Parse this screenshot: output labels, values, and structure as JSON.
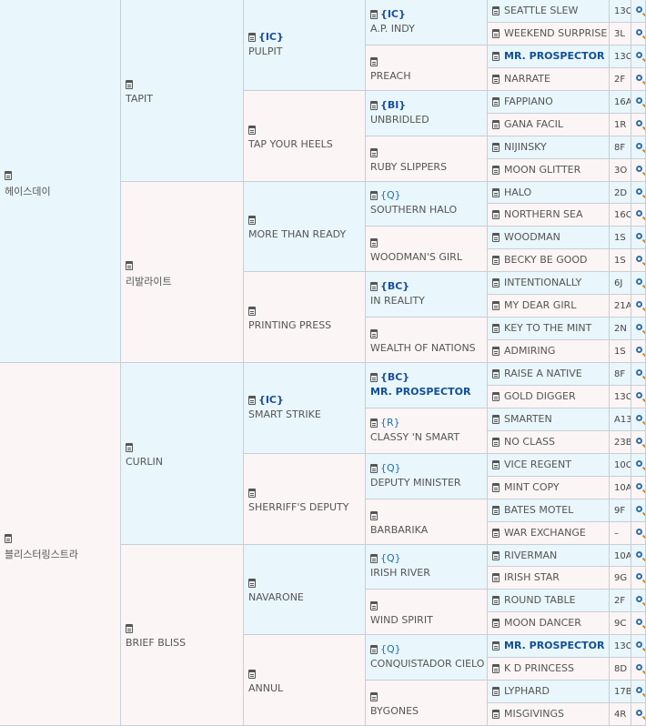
{
  "gen1": [
    "헤이스데이",
    "블리스터링스트라"
  ],
  "gen2": [
    "TAPIT",
    "리발라이트",
    "CURLIN",
    "BRIEF BLISS"
  ],
  "gen3": [
    {
      "badge": "{IC}",
      "name": "PULPIT"
    },
    {
      "badge": "",
      "name": "TAP YOUR HEELS"
    },
    {
      "badge": "",
      "name": "MORE THAN READY"
    },
    {
      "badge": "",
      "name": "PRINTING PRESS"
    },
    {
      "badge": "{IC}",
      "name": "SMART STRIKE"
    },
    {
      "badge": "",
      "name": "SHERRIFF'S DEPUTY"
    },
    {
      "badge": "",
      "name": "NAVARONE"
    },
    {
      "badge": "",
      "name": "ANNUL"
    }
  ],
  "gen4": [
    {
      "badge": "{IC}",
      "name": "A.P. INDY",
      "hl": false,
      "light": false
    },
    {
      "badge": "",
      "name": "PREACH",
      "hl": false,
      "light": false
    },
    {
      "badge": "{BI}",
      "name": "UNBRIDLED",
      "hl": false,
      "light": false
    },
    {
      "badge": "",
      "name": "RUBY SLIPPERS",
      "hl": false,
      "light": false
    },
    {
      "badge": "{Q}",
      "name": "SOUTHERN HALO",
      "hl": false,
      "light": true
    },
    {
      "badge": "",
      "name": "WOODMAN'S GIRL",
      "hl": false,
      "light": false
    },
    {
      "badge": "{BC}",
      "name": "IN REALITY",
      "hl": false,
      "light": false
    },
    {
      "badge": "",
      "name": "WEALTH OF NATIONS",
      "hl": false,
      "light": false
    },
    {
      "badge": "{BC}",
      "name": "MR. PROSPECTOR",
      "hl": true,
      "light": false
    },
    {
      "badge": "{R}",
      "name": "CLASSY 'N SMART",
      "hl": false,
      "light": true
    },
    {
      "badge": "{Q}",
      "name": "DEPUTY MINISTER",
      "hl": false,
      "light": true
    },
    {
      "badge": "",
      "name": "BARBARIKA",
      "hl": false,
      "light": false
    },
    {
      "badge": "{Q}",
      "name": "IRISH RIVER",
      "hl": false,
      "light": true
    },
    {
      "badge": "",
      "name": "WIND SPIRIT",
      "hl": false,
      "light": false
    },
    {
      "badge": "{Q}",
      "name": "CONQUISTADOR CIELO",
      "hl": false,
      "light": true
    },
    {
      "badge": "",
      "name": "BYGONES",
      "hl": false,
      "light": false
    }
  ],
  "gen5": [
    {
      "name": "SEATTLE SLEW",
      "family": "13C",
      "hl": false
    },
    {
      "name": "WEEKEND SURPRISE",
      "family": "3L",
      "hl": false
    },
    {
      "name": "MR. PROSPECTOR",
      "family": "13C",
      "hl": true
    },
    {
      "name": "NARRATE",
      "family": "2F",
      "hl": false
    },
    {
      "name": "FAPPIANO",
      "family": "16A",
      "hl": false
    },
    {
      "name": "GANA FACIL",
      "family": "1R",
      "hl": false
    },
    {
      "name": "NIJINSKY",
      "family": "8F",
      "hl": false
    },
    {
      "name": "MOON GLITTER",
      "family": "3O",
      "hl": false
    },
    {
      "name": "HALO",
      "family": "2D",
      "hl": false
    },
    {
      "name": "NORTHERN SEA",
      "family": "16C",
      "hl": false
    },
    {
      "name": "WOODMAN",
      "family": "1S",
      "hl": false
    },
    {
      "name": "BECKY BE GOOD",
      "family": "1S",
      "hl": false
    },
    {
      "name": "INTENTIONALLY",
      "family": "6J",
      "hl": false
    },
    {
      "name": "MY DEAR GIRL",
      "family": "21A",
      "hl": false
    },
    {
      "name": "KEY TO THE MINT",
      "family": "2N",
      "hl": false
    },
    {
      "name": "ADMIRING",
      "family": "1S",
      "hl": false
    },
    {
      "name": "RAISE A NATIVE",
      "family": "8F",
      "hl": false
    },
    {
      "name": "GOLD DIGGER",
      "family": "13C",
      "hl": false
    },
    {
      "name": "SMARTEN",
      "family": "A13",
      "hl": false
    },
    {
      "name": "NO CLASS",
      "family": "23B",
      "hl": false
    },
    {
      "name": "VICE REGENT",
      "family": "10C",
      "hl": false
    },
    {
      "name": "MINT COPY",
      "family": "10A",
      "hl": false
    },
    {
      "name": "BATES MOTEL",
      "family": "9F",
      "hl": false
    },
    {
      "name": "WAR EXCHANGE",
      "family": "–",
      "hl": false
    },
    {
      "name": "RIVERMAN",
      "family": "10A",
      "hl": false
    },
    {
      "name": "IRISH STAR",
      "family": "9G",
      "hl": false
    },
    {
      "name": "ROUND TABLE",
      "family": "2F",
      "hl": false
    },
    {
      "name": "MOON DANCER",
      "family": "9C",
      "hl": false
    },
    {
      "name": "MR. PROSPECTOR",
      "family": "13C",
      "hl": true
    },
    {
      "name": "K D PRINCESS",
      "family": "8D",
      "hl": false
    },
    {
      "name": "LYPHARD",
      "family": "17B",
      "hl": false
    },
    {
      "name": "MISGIVINGS",
      "family": "4R",
      "hl": false
    }
  ],
  "icons": {
    "record": "clipboard-icon",
    "search": "magnifier-icon"
  },
  "colors": {
    "sire_bg": "#e9f6fb",
    "dam_bg": "#fcf5f5",
    "highlight": "#114f95",
    "badge": "#1a4ea3"
  }
}
